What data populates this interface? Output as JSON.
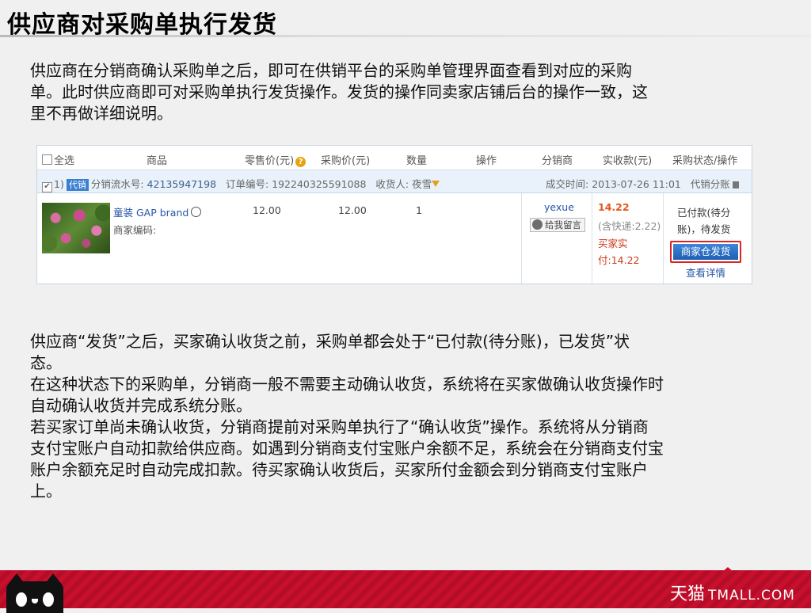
{
  "slide": {
    "title": "供应商对采购单执行发货",
    "intro": "供应商在分销商确认采购单之后，即可在供销平台的采购单管理界面查看到对应的采购单。此时供应商即可对采购单执行发货操作。发货的操作同卖家店铺后台的操作一致，这里不再做详细说明。",
    "intro_lines": [
      "供应商在分销商确认采购单之后，即可在供销平台的采购单管理界面查看到对应的采购",
      "单。此时供应商即可对采购单执行发货操作。发货的操作同卖家店铺后台的操作一致，这",
      "里不再做详细说明。"
    ],
    "para2_lines": [
      "供应商“发货”之后，买家确认收货之前，采购单都会处于“已付款(待分账)，已发货”状",
      "态。",
      "在这种状态下的采购单，分销商一般不需要主动确认收货，系统将在买家做确认收货操作时",
      "自动确认收货并完成系统分账。",
      "若买家订单尚未确认收货，分销商提前对采购单执行了“确认收货”操作。系统将从分销商",
      "支付宝账户自动扣款给供应商。如遇到分销商支付宝账户余额不足，系统会在分销商支付宝",
      "账户余额充足时自动完成扣款。待买家确认收货后，买家所付金额会到分销商支付宝账户",
      "上。"
    ]
  },
  "table": {
    "headers": {
      "select_all": "全选",
      "product": "商品",
      "retail_price": "零售价(元)",
      "purchase_price": "采购价(元)",
      "quantity": "数量",
      "operation": "操作",
      "distributor": "分销商",
      "received": "实收款(元)",
      "status": "采购状态/操作"
    },
    "order": {
      "index": "1)",
      "tag": "代销",
      "serial_label": "分销流水号:",
      "serial": "42135947198",
      "order_label": "订单编号:",
      "order_no": "192240325591088",
      "receiver_label": "收货人:",
      "receiver": "夜雪",
      "deal_time_label": "成交时间:",
      "deal_time": "2013-07-26 11:01",
      "split_label": "代销分账"
    },
    "item": {
      "name": "童装 GAP brand",
      "merchant_code_label": "商家编码:",
      "retail_price": "12.00",
      "purchase_price": "12.00",
      "quantity": "1",
      "distributor": "yexue",
      "message_button": "给我留言",
      "received_amount": "14.22",
      "shipping_note": "(含快递:2.22)",
      "buyer_paid_label": "买家实",
      "buyer_paid": "付:14.22",
      "status_line1": "已付款(待分",
      "status_line2": "账)，待发货",
      "ship_button": "商家仓发货",
      "view_details": "查看详情"
    }
  },
  "footer": {
    "brand_cn": "天猫",
    "brand_en": "TMALL.COM",
    "color": "#c8102e"
  }
}
